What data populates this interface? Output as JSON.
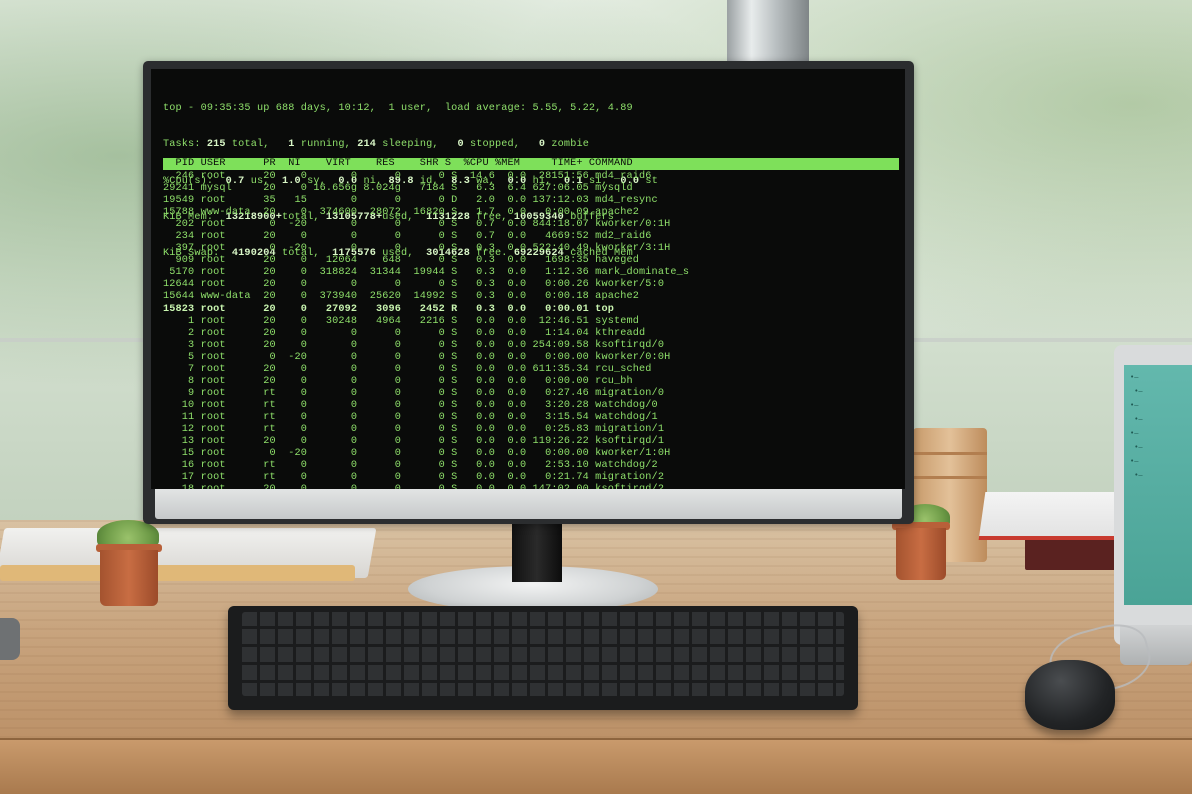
{
  "top_summary": {
    "line1": "top - 09:35:35 up 688 days, 10:12,  1 user,  load average: 5.55, 5.22, 4.89",
    "line2_parts": [
      "Tasks: ",
      "215",
      " total,   ",
      "1",
      " running, ",
      "214",
      " sleeping,   ",
      "0",
      " stopped,   ",
      "0",
      " zombie"
    ],
    "line3_parts": [
      "%Cpu(s):  ",
      "0.7",
      " us,  ",
      "1.0",
      " sy,  ",
      "0.0",
      " ni, ",
      "89.8",
      " id,  ",
      "8.3",
      " wa,  ",
      "0.0",
      " hi,  ",
      "0.1",
      " si,  ",
      "0.0",
      " st"
    ],
    "line4_parts": [
      "KiB Mem:  ",
      "13218900+",
      "total, ",
      "13105778+",
      "used,  ",
      "1131228",
      " free, ",
      "10059340",
      " buffers"
    ],
    "line5_parts": [
      "KiB Swap:  ",
      "4190204",
      " total,  ",
      "1175576",
      " used,  ",
      "3014628",
      " free. ",
      "69229624",
      " cached Mem"
    ]
  },
  "process_header": "  PID USER      PR  NI    VIRT    RES    SHR S  %CPU %MEM     TIME+ COMMAND",
  "processes": [
    {
      "pid": "246",
      "user": "root",
      "pr": "20",
      "ni": "0",
      "virt": "0",
      "res": "0",
      "shr": "0",
      "s": "S",
      "cpu": "14.6",
      "mem": "0.0",
      "time": "28151:56",
      "command": "md4_raid6"
    },
    {
      "pid": "29241",
      "user": "mysql",
      "pr": "20",
      "ni": "0",
      "virt": "16.656g",
      "res": "8.024g",
      "shr": "7184",
      "s": "S",
      "cpu": "6.3",
      "mem": "6.4",
      "time": "627:06.05",
      "command": "mysqld"
    },
    {
      "pid": "19549",
      "user": "root",
      "pr": "35",
      "ni": "15",
      "virt": "0",
      "res": "0",
      "shr": "0",
      "s": "D",
      "cpu": "2.0",
      "mem": "0.0",
      "time": "137:12.03",
      "command": "md4_resync"
    },
    {
      "pid": "15788",
      "user": "www-data",
      "pr": "20",
      "ni": "0",
      "virt": "374600",
      "res": "28072",
      "shr": "16820",
      "s": "S",
      "cpu": "1.7",
      "mem": "0.0",
      "time": "0:00.09",
      "command": "apache2"
    },
    {
      "pid": "202",
      "user": "root",
      "pr": "0",
      "ni": "-20",
      "virt": "0",
      "res": "0",
      "shr": "0",
      "s": "S",
      "cpu": "0.7",
      "mem": "0.0",
      "time": "844:18.07",
      "command": "kworker/0:1H"
    },
    {
      "pid": "234",
      "user": "root",
      "pr": "20",
      "ni": "0",
      "virt": "0",
      "res": "0",
      "shr": "0",
      "s": "S",
      "cpu": "0.7",
      "mem": "0.0",
      "time": "4669:52",
      "command": "md2_raid6"
    },
    {
      "pid": "397",
      "user": "root",
      "pr": "0",
      "ni": "-20",
      "virt": "0",
      "res": "0",
      "shr": "0",
      "s": "S",
      "cpu": "0.3",
      "mem": "0.0",
      "time": "522:40.49",
      "command": "kworker/3:1H"
    },
    {
      "pid": "909",
      "user": "root",
      "pr": "20",
      "ni": "0",
      "virt": "12064",
      "res": "648",
      "shr": "0",
      "s": "S",
      "cpu": "0.3",
      "mem": "0.0",
      "time": "1698:35",
      "command": "haveged"
    },
    {
      "pid": "5170",
      "user": "root",
      "pr": "20",
      "ni": "0",
      "virt": "318824",
      "res": "31344",
      "shr": "19944",
      "s": "S",
      "cpu": "0.3",
      "mem": "0.0",
      "time": "1:12.36",
      "command": "mark_dominate_s"
    },
    {
      "pid": "12644",
      "user": "root",
      "pr": "20",
      "ni": "0",
      "virt": "0",
      "res": "0",
      "shr": "0",
      "s": "S",
      "cpu": "0.3",
      "mem": "0.0",
      "time": "0:00.26",
      "command": "kworker/5:0"
    },
    {
      "pid": "15644",
      "user": "www-data",
      "pr": "20",
      "ni": "0",
      "virt": "373940",
      "res": "25620",
      "shr": "14992",
      "s": "S",
      "cpu": "0.3",
      "mem": "0.0",
      "time": "0:00.18",
      "command": "apache2"
    },
    {
      "pid": "15823",
      "user": "root",
      "pr": "20",
      "ni": "0",
      "virt": "27092",
      "res": "3096",
      "shr": "2452",
      "s": "R",
      "cpu": "0.3",
      "mem": "0.0",
      "time": "0:00.01",
      "command": "top",
      "bold": true
    },
    {
      "pid": "1",
      "user": "root",
      "pr": "20",
      "ni": "0",
      "virt": "30248",
      "res": "4964",
      "shr": "2216",
      "s": "S",
      "cpu": "0.0",
      "mem": "0.0",
      "time": "12:46.51",
      "command": "systemd"
    },
    {
      "pid": "2",
      "user": "root",
      "pr": "20",
      "ni": "0",
      "virt": "0",
      "res": "0",
      "shr": "0",
      "s": "S",
      "cpu": "0.0",
      "mem": "0.0",
      "time": "1:14.04",
      "command": "kthreadd"
    },
    {
      "pid": "3",
      "user": "root",
      "pr": "20",
      "ni": "0",
      "virt": "0",
      "res": "0",
      "shr": "0",
      "s": "S",
      "cpu": "0.0",
      "mem": "0.0",
      "time": "254:09.58",
      "command": "ksoftirqd/0"
    },
    {
      "pid": "5",
      "user": "root",
      "pr": "0",
      "ni": "-20",
      "virt": "0",
      "res": "0",
      "shr": "0",
      "s": "S",
      "cpu": "0.0",
      "mem": "0.0",
      "time": "0:00.00",
      "command": "kworker/0:0H"
    },
    {
      "pid": "7",
      "user": "root",
      "pr": "20",
      "ni": "0",
      "virt": "0",
      "res": "0",
      "shr": "0",
      "s": "S",
      "cpu": "0.0",
      "mem": "0.0",
      "time": "611:35.34",
      "command": "rcu_sched"
    },
    {
      "pid": "8",
      "user": "root",
      "pr": "20",
      "ni": "0",
      "virt": "0",
      "res": "0",
      "shr": "0",
      "s": "S",
      "cpu": "0.0",
      "mem": "0.0",
      "time": "0:00.00",
      "command": "rcu_bh"
    },
    {
      "pid": "9",
      "user": "root",
      "pr": "rt",
      "ni": "0",
      "virt": "0",
      "res": "0",
      "shr": "0",
      "s": "S",
      "cpu": "0.0",
      "mem": "0.0",
      "time": "0:27.46",
      "command": "migration/0"
    },
    {
      "pid": "10",
      "user": "root",
      "pr": "rt",
      "ni": "0",
      "virt": "0",
      "res": "0",
      "shr": "0",
      "s": "S",
      "cpu": "0.0",
      "mem": "0.0",
      "time": "3:20.28",
      "command": "watchdog/0"
    },
    {
      "pid": "11",
      "user": "root",
      "pr": "rt",
      "ni": "0",
      "virt": "0",
      "res": "0",
      "shr": "0",
      "s": "S",
      "cpu": "0.0",
      "mem": "0.0",
      "time": "3:15.54",
      "command": "watchdog/1"
    },
    {
      "pid": "12",
      "user": "root",
      "pr": "rt",
      "ni": "0",
      "virt": "0",
      "res": "0",
      "shr": "0",
      "s": "S",
      "cpu": "0.0",
      "mem": "0.0",
      "time": "0:25.83",
      "command": "migration/1"
    },
    {
      "pid": "13",
      "user": "root",
      "pr": "20",
      "ni": "0",
      "virt": "0",
      "res": "0",
      "shr": "0",
      "s": "S",
      "cpu": "0.0",
      "mem": "0.0",
      "time": "119:26.22",
      "command": "ksoftirqd/1"
    },
    {
      "pid": "15",
      "user": "root",
      "pr": "0",
      "ni": "-20",
      "virt": "0",
      "res": "0",
      "shr": "0",
      "s": "S",
      "cpu": "0.0",
      "mem": "0.0",
      "time": "0:00.00",
      "command": "kworker/1:0H"
    },
    {
      "pid": "16",
      "user": "root",
      "pr": "rt",
      "ni": "0",
      "virt": "0",
      "res": "0",
      "shr": "0",
      "s": "S",
      "cpu": "0.0",
      "mem": "0.0",
      "time": "2:53.10",
      "command": "watchdog/2"
    },
    {
      "pid": "17",
      "user": "root",
      "pr": "rt",
      "ni": "0",
      "virt": "0",
      "res": "0",
      "shr": "0",
      "s": "S",
      "cpu": "0.0",
      "mem": "0.0",
      "time": "0:21.74",
      "command": "migration/2"
    },
    {
      "pid": "18",
      "user": "root",
      "pr": "20",
      "ni": "0",
      "virt": "0",
      "res": "0",
      "shr": "0",
      "s": "S",
      "cpu": "0.0",
      "mem": "0.0",
      "time": "147:02.00",
      "command": "ksoftirqd/2"
    }
  ],
  "colors": {
    "terminal_text": "#8fe06b",
    "header_bar": "#7ee05a",
    "screen_bg": "#0a0b0a"
  }
}
